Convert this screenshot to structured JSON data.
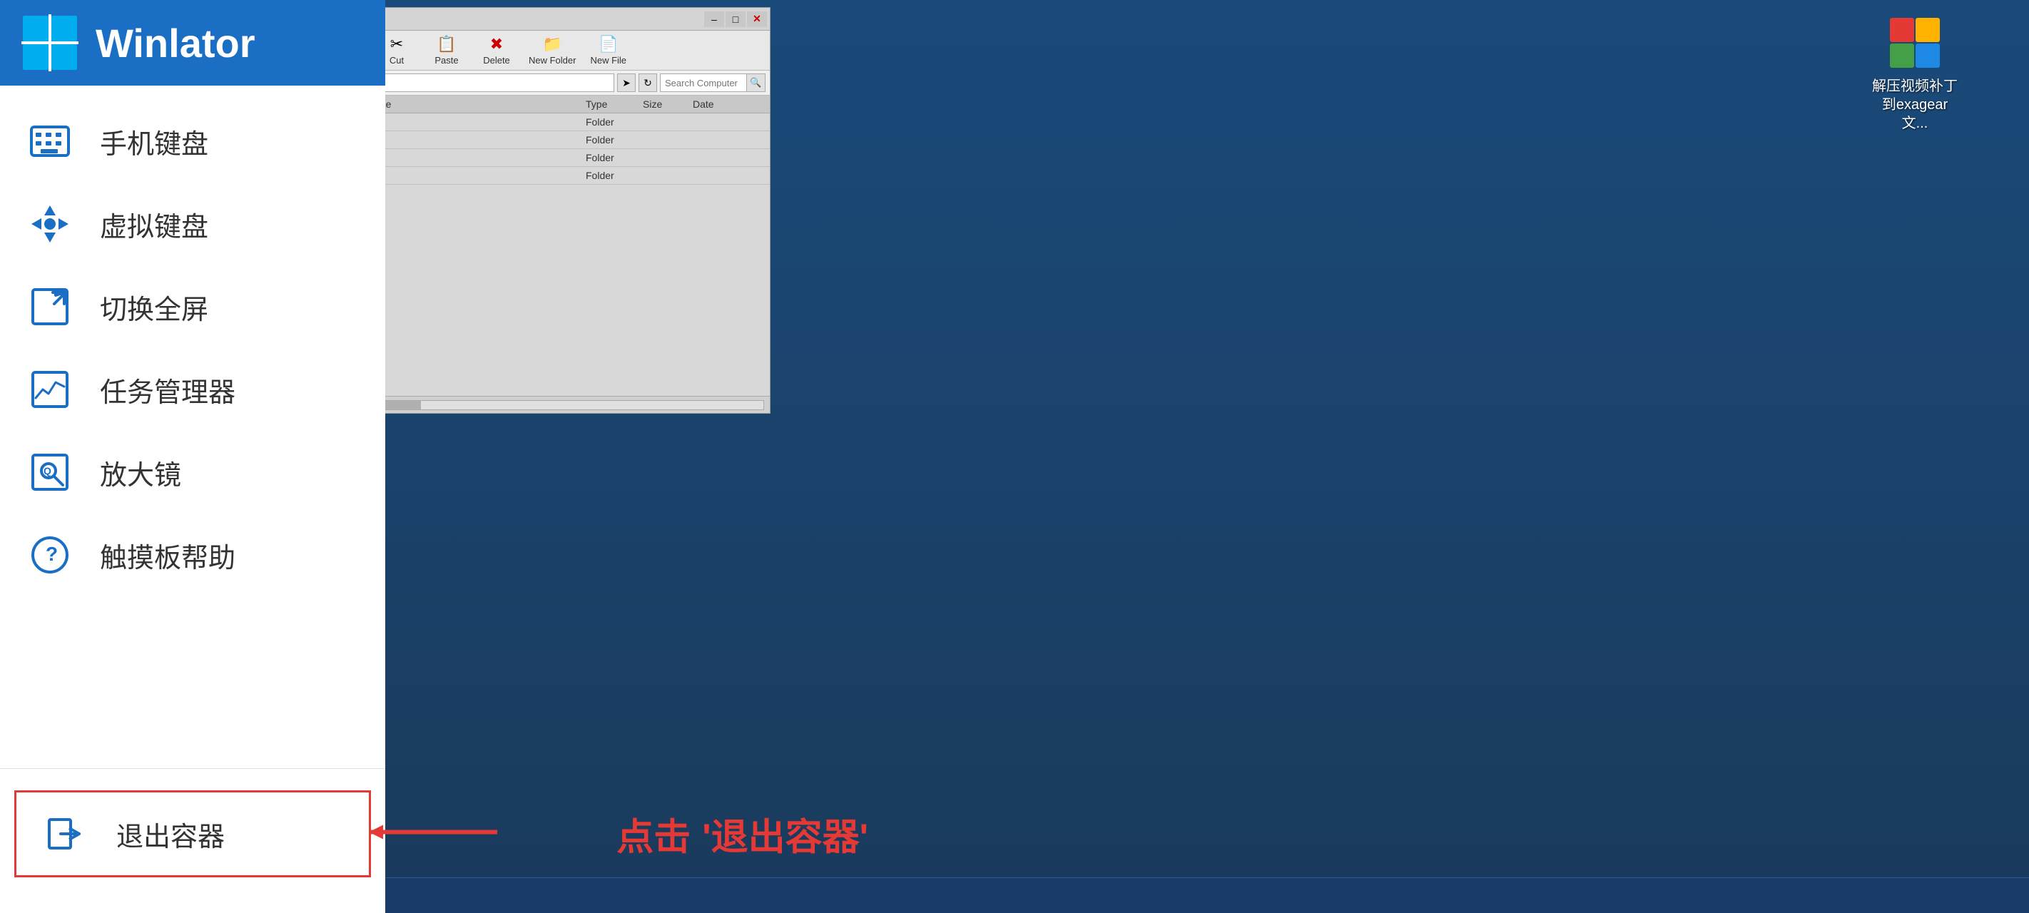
{
  "app": {
    "title": "Winlator"
  },
  "sidebar": {
    "items": [
      {
        "id": "mobile-keyboard",
        "label": "手机键盘"
      },
      {
        "id": "virtual-keyboard",
        "label": "虚拟键盘"
      },
      {
        "id": "fullscreen",
        "label": "切换全屏"
      },
      {
        "id": "task-manager",
        "label": "任务管理器"
      },
      {
        "id": "magnifier",
        "label": "放大镜"
      },
      {
        "id": "touchpad-help",
        "label": "触摸板帮助"
      }
    ],
    "exit": {
      "label": "退出容器"
    }
  },
  "annotation": {
    "click_text": "点击",
    "exit_text": "'退出容器'"
  },
  "file_explorer": {
    "toolbar": {
      "cut": "Cut",
      "paste": "Paste",
      "delete": "Delete",
      "new_folder": "New Folder",
      "new_file": "New File"
    },
    "search_placeholder": "Search Computer",
    "columns": {
      "name": "me",
      "type": "Type",
      "size": "Size",
      "date": "Date"
    },
    "rows": [
      {
        "name": "",
        "type": "Folder",
        "size": "",
        "date": ""
      },
      {
        "name": "",
        "type": "Folder",
        "size": "",
        "date": ""
      },
      {
        "name": "",
        "type": "Folder",
        "size": "",
        "date": ""
      },
      {
        "name": "",
        "type": "Folder",
        "size": "",
        "date": ""
      }
    ]
  },
  "desktop_icon": {
    "label": "解压视频补丁到exagear文..."
  }
}
